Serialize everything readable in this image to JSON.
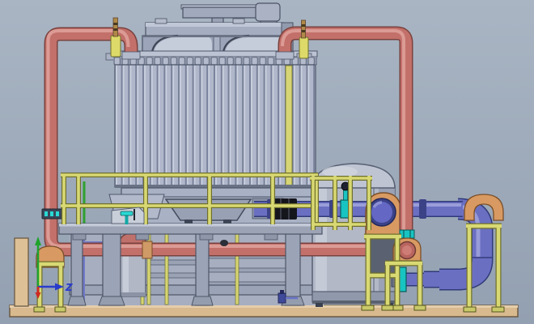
{
  "viewport": {
    "axis_triad": {
      "z_label": "Z",
      "x_axis_color": "#cc2a22",
      "y_axis_color": "#1fa32c",
      "z_axis_color": "#2a3ccc"
    },
    "background_top": "#a9b5c3",
    "background_bottom": "#93a0b1"
  },
  "palette": {
    "pipe_red": "#c3706a",
    "pipe_red_highlight": "#dfa09a",
    "pipe_blue": "#6b6fc2",
    "pipe_blue_highlight": "#9fa3dc",
    "support_yellow": "#d9d974",
    "saddle_orange": "#d89a62",
    "valve_teal": "#18c4c2",
    "structure_gray": "#aeb5c7",
    "base_tan": "#d8ba8e",
    "brass": "#b08948"
  }
}
